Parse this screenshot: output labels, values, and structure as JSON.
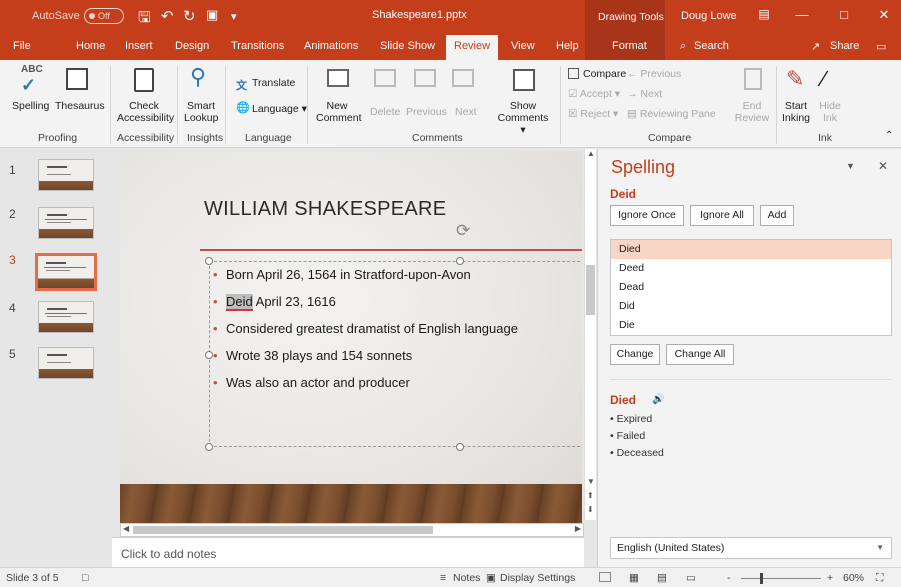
{
  "titlebar": {
    "autosave_label": "AutoSave",
    "autosave_state": "Off",
    "doc_title": "Shakespeare1.pptx",
    "context_label": "Drawing Tools",
    "user_name": "Doug Lowe",
    "icons": [
      "save-icon",
      "undo-icon",
      "redo-icon",
      "start-from-beginning-icon",
      "customize-qat-icon",
      "ribbon-display-icon",
      "minimize-icon",
      "maximize-icon",
      "close-icon"
    ]
  },
  "tabs": {
    "file": "File",
    "home": "Home",
    "insert": "Insert",
    "design": "Design",
    "transitions": "Transitions",
    "animations": "Animations",
    "slideshow": "Slide Show",
    "review": "Review",
    "view": "View",
    "help": "Help",
    "format": "Format",
    "search": "Search",
    "share": "Share"
  },
  "ribbon": {
    "spelling": "Spelling",
    "thesaurus": "Thesaurus",
    "proofing": "Proofing",
    "check": "Check",
    "accessibility": "Accessibility",
    "accessibility_group": "Accessibility",
    "smart": "Smart",
    "lookup": "Lookup",
    "insights": "Insights",
    "translate": "Translate",
    "language_btn": "Language",
    "language_group": "Language",
    "new": "New",
    "comment": "Comment",
    "delete": "Delete",
    "previous": "Previous",
    "next": "Next",
    "show": "Show",
    "comments_btn": "Comments",
    "comments_group": "Comments",
    "compare": "Compare",
    "accept": "Accept",
    "reject": "Reject",
    "prev_change": "Previous",
    "next_change": "Next",
    "reviewing_pane": "Reviewing Pane",
    "end": "End",
    "review": "Review",
    "compare_group": "Compare",
    "start": "Start",
    "inking": "Inking",
    "hide": "Hide",
    "ink": "Ink",
    "ink_group": "Ink"
  },
  "thumbnails": [
    {
      "num": "1"
    },
    {
      "num": "2"
    },
    {
      "num": "3"
    },
    {
      "num": "4"
    },
    {
      "num": "5"
    }
  ],
  "slide": {
    "title": "WILLIAM SHAKESPEARE",
    "bullets": {
      "b1": "Born April 26, 1564 in Stratford-upon-Avon",
      "b2_err": "Deid",
      "b2_rest": " April 23, 1616",
      "b3": "Considered greatest dramatist of English language",
      "b4": "Wrote 38 plays and 154 sonnets",
      "b5": "Was also an actor and producer"
    }
  },
  "notes_placeholder": "Click to add notes",
  "spelling_pane": {
    "title": "Spelling",
    "misspelled_word": "Deid",
    "ignore_once": "Ignore Once",
    "ignore_all": "Ignore All",
    "add": "Add",
    "suggestions": [
      "Died",
      "Deed",
      "Dead",
      "Did",
      "Die"
    ],
    "change": "Change",
    "change_all": "Change All",
    "definition_word": "Died",
    "synonyms": [
      "Expired",
      "Failed",
      "Deceased"
    ],
    "language": "English (United States)"
  },
  "status": {
    "slide_count": "Slide 3 of 5",
    "notes": "Notes",
    "display_settings": "Display Settings",
    "zoom_minus": "-",
    "zoom_plus": "+",
    "zoom_level": "60%"
  },
  "colors": {
    "accent": "#c43e1c",
    "selection": "#f9d5c6",
    "slide_rule": "#c0504d"
  }
}
